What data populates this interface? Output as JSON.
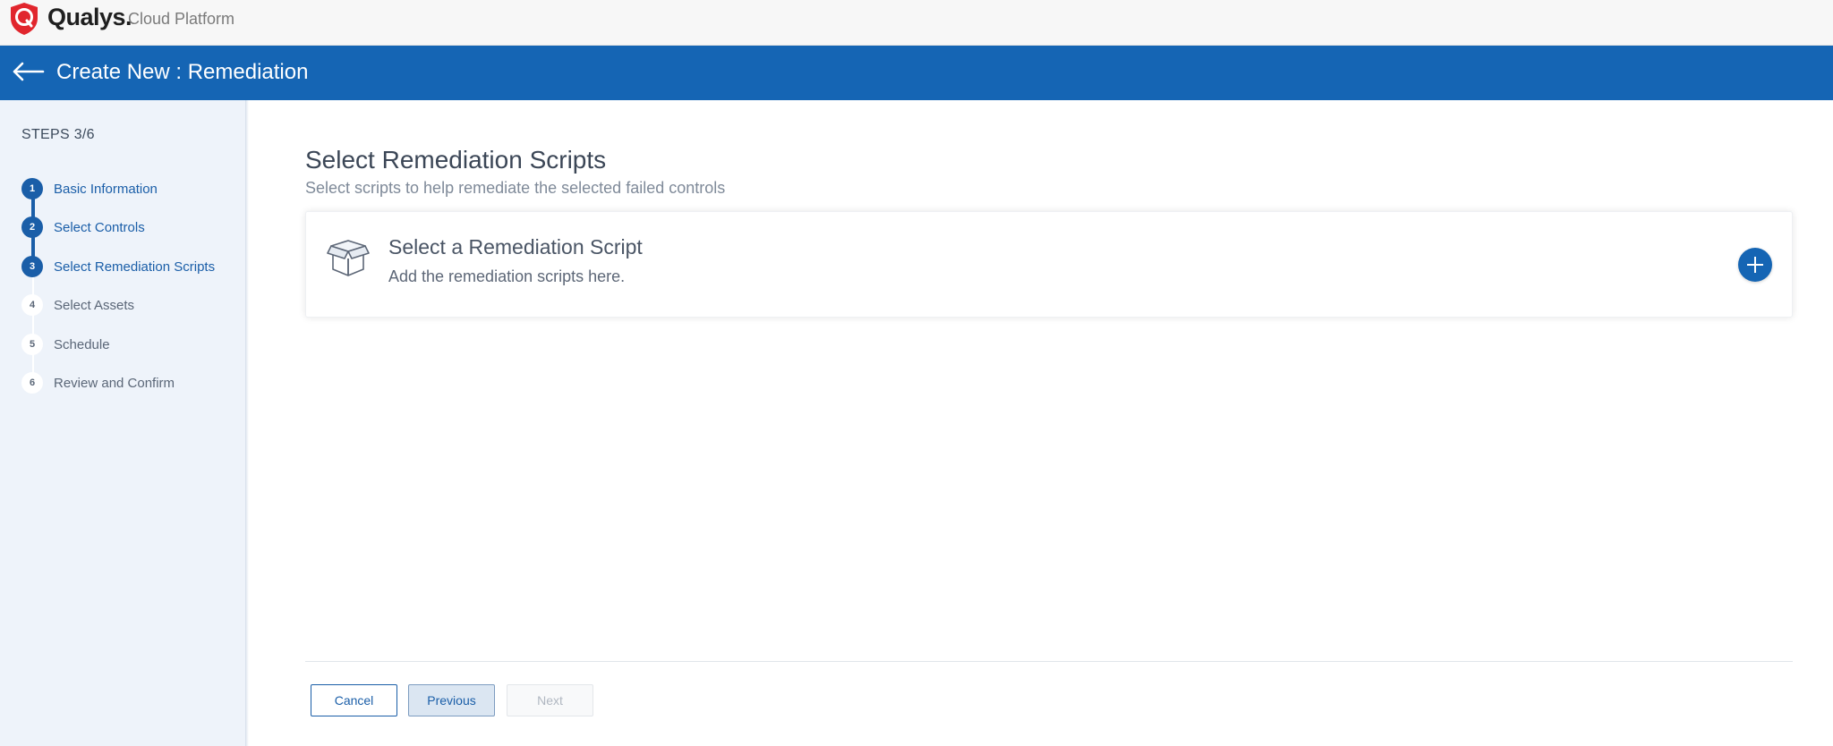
{
  "brand": {
    "name": "Qualys.",
    "sub": "Cloud Platform",
    "accent": "#e1262d"
  },
  "header": {
    "title": "Create New : Remediation",
    "color": "#1565b4"
  },
  "sidebar": {
    "heading": "STEPS 3/6",
    "steps": [
      {
        "num": "1",
        "label": "Basic Information",
        "state": "done"
      },
      {
        "num": "2",
        "label": "Select Controls",
        "state": "done"
      },
      {
        "num": "3",
        "label": "Select Remediation Scripts",
        "state": "current"
      },
      {
        "num": "4",
        "label": "Select Assets",
        "state": "todo"
      },
      {
        "num": "5",
        "label": "Schedule",
        "state": "todo"
      },
      {
        "num": "6",
        "label": "Review and Confirm",
        "state": "todo"
      }
    ]
  },
  "main": {
    "title": "Select Remediation Scripts",
    "subtitle": "Select scripts to help remediate the selected failed controls",
    "card": {
      "icon": "open-box-icon",
      "title": "Select a Remediation Script",
      "description": "Add the remediation scripts here."
    }
  },
  "footer": {
    "cancel_label": "Cancel",
    "previous_label": "Previous",
    "next_label": "Next"
  }
}
